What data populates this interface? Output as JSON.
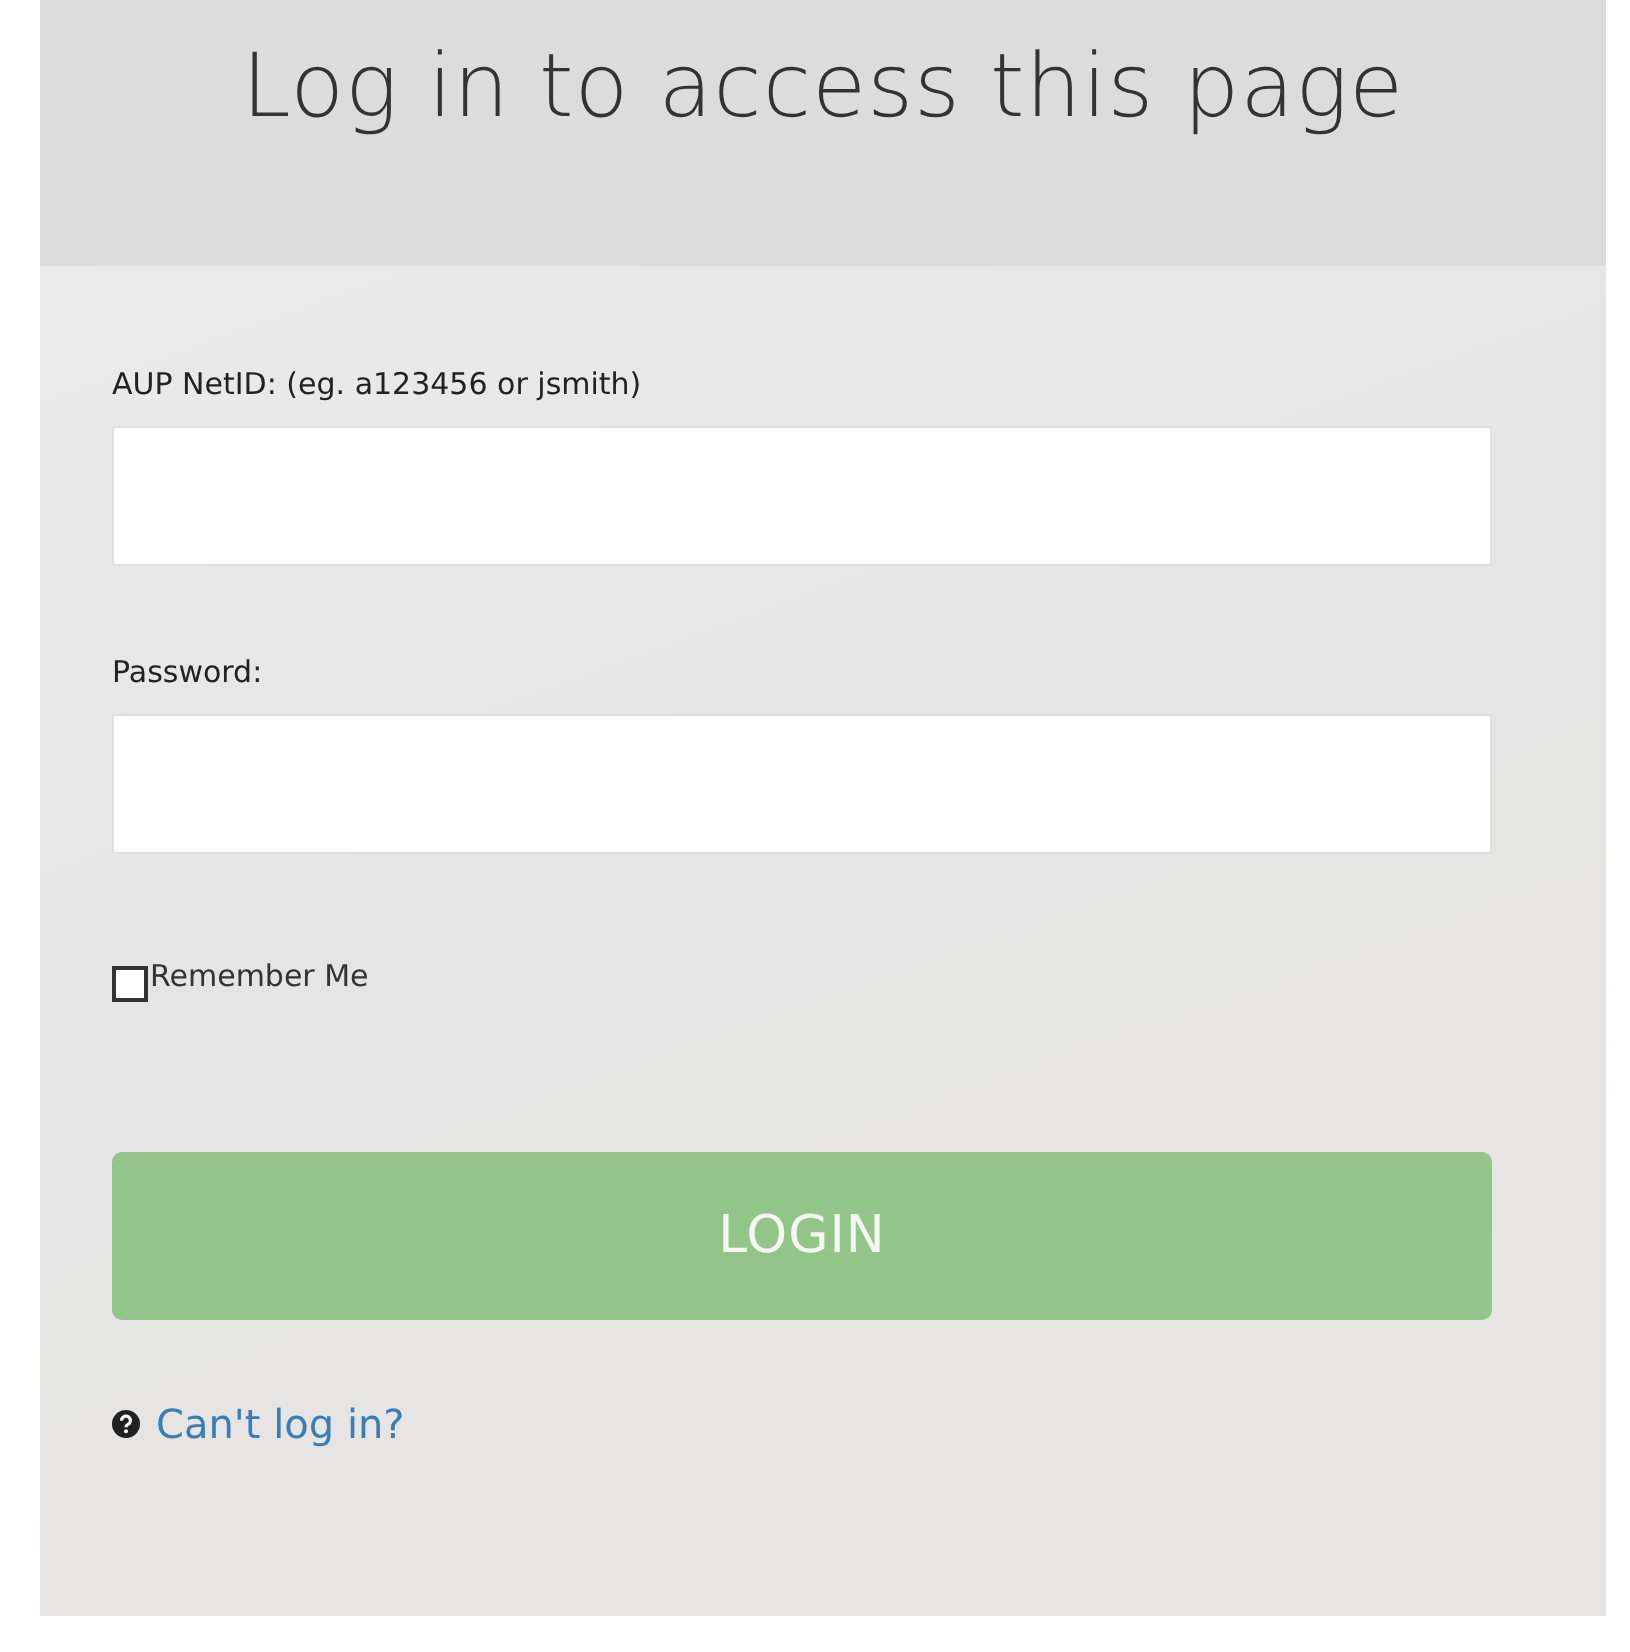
{
  "title": "Log in to access this page",
  "fields": [
    {
      "label": "AUP NetID: (eg. a123456 or jsmith)"
    },
    {
      "label": "Password:"
    }
  ],
  "remember_me": {
    "label": "Remember Me",
    "checked": false
  },
  "login_button": "LOGIN",
  "help_link": "Can't log in?"
}
